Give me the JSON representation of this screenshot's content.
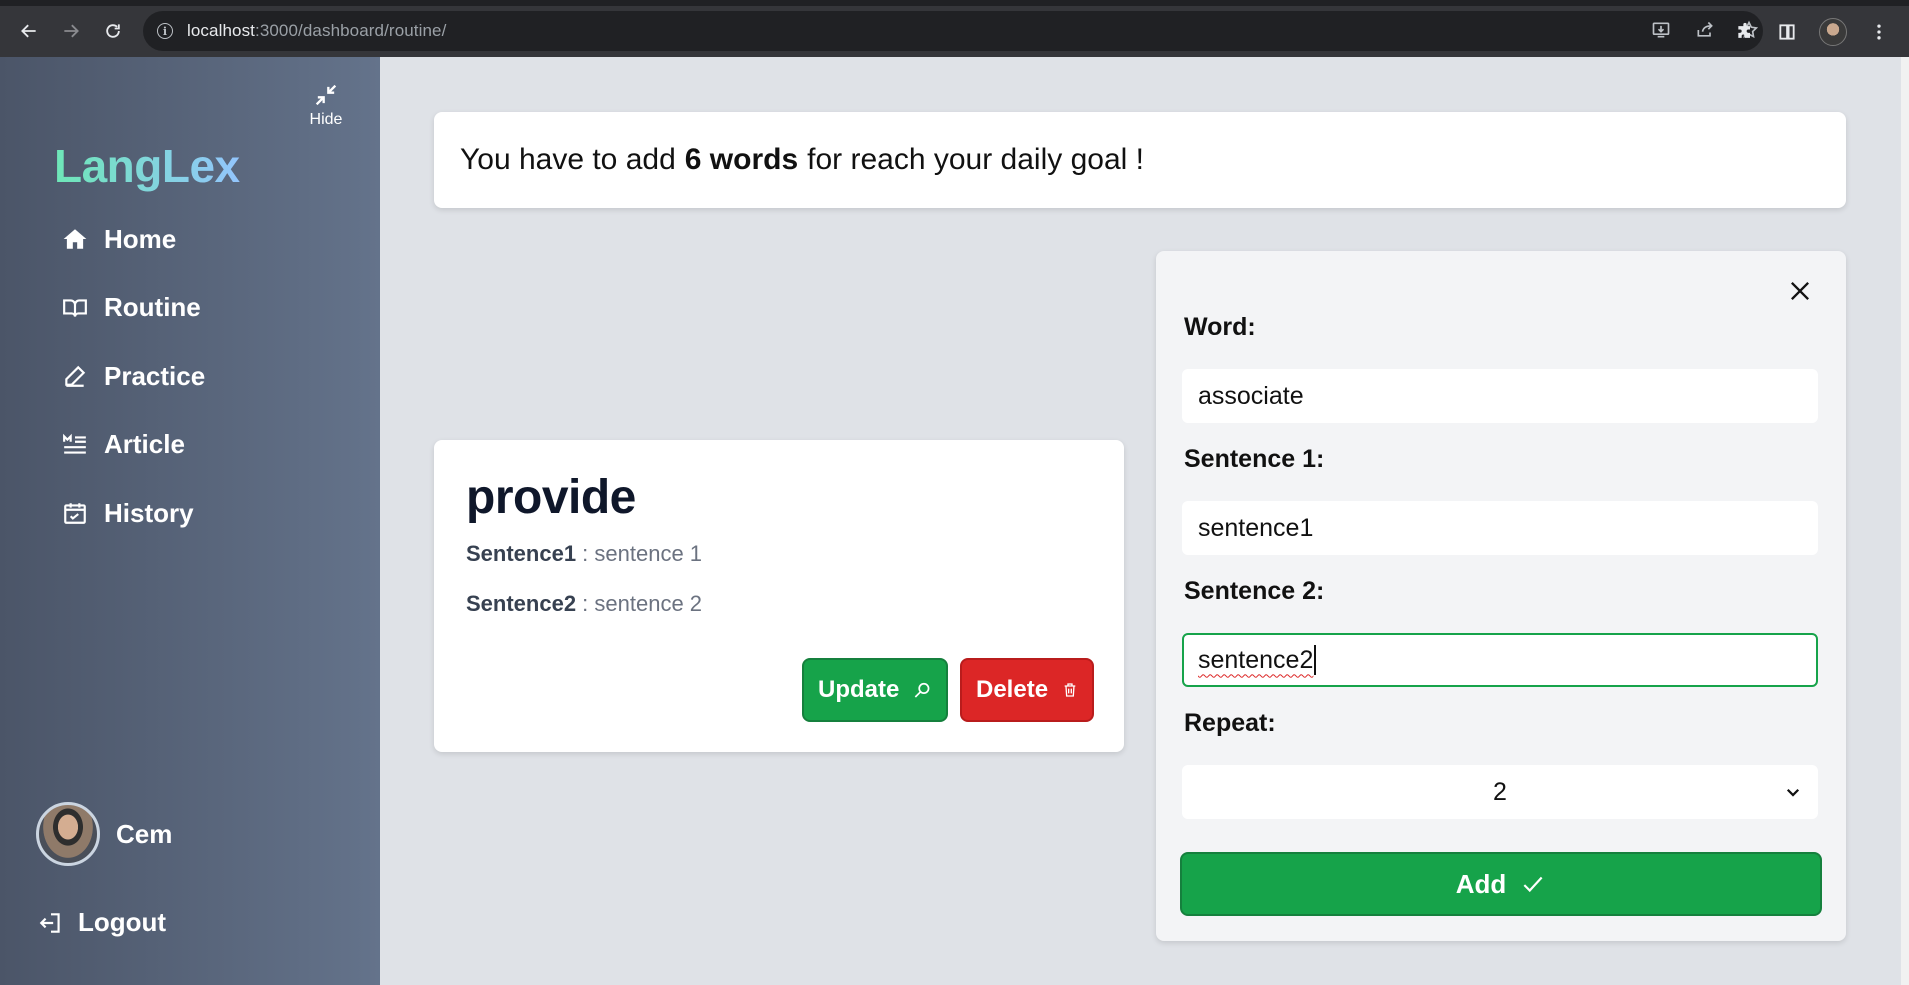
{
  "browser": {
    "url_host": "localhost",
    "url_rest": ":3000/dashboard/routine/"
  },
  "sidebar": {
    "hide_label": "Hide",
    "logo": "LangLex",
    "items": [
      {
        "label": "Home",
        "icon": "home-icon"
      },
      {
        "label": "Routine",
        "icon": "book-open-icon"
      },
      {
        "label": "Practice",
        "icon": "pencil-icon"
      },
      {
        "label": "Article",
        "icon": "article-icon"
      },
      {
        "label": "History",
        "icon": "calendar-check-icon"
      }
    ],
    "user_name": "Cem",
    "logout_label": "Logout"
  },
  "banner": {
    "prefix": "You have to add",
    "highlight": "6 words",
    "suffix": "for reach your daily goal !"
  },
  "word_card": {
    "word": "provide",
    "sentence1_label": "Sentence1",
    "sentence1_value": "sentence 1",
    "sentence2_label": "Sentence2",
    "sentence2_value": "sentence 2",
    "update_label": "Update",
    "delete_label": "Delete"
  },
  "form": {
    "word_label": "Word:",
    "word_value": "associate",
    "sentence1_label": "Sentence 1:",
    "sentence1_value": "sentence1",
    "sentence2_label": "Sentence 2:",
    "sentence2_value": "sentence2",
    "repeat_label": "Repeat:",
    "repeat_value": "2",
    "add_label": "Add"
  },
  "colors": {
    "green": "#16a34a",
    "red": "#dc2626",
    "sidebar_dark": "#4b5568",
    "sidebar_light": "#64738b"
  }
}
